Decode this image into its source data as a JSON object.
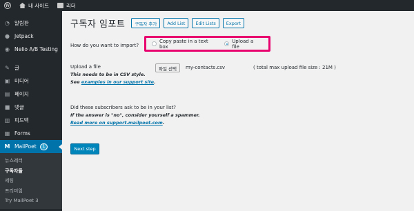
{
  "admin_bar": {
    "site_label": "내 사이트",
    "reader_label": "리더"
  },
  "sidebar": {
    "items": [
      {
        "label": "알림판",
        "icon": "dashboard-icon"
      },
      {
        "label": "Jetpack",
        "icon": "jetpack-icon"
      },
      {
        "label": "Nelio A/B Testing",
        "icon": "nelio-icon"
      },
      {
        "label": "글",
        "icon": "pin-icon"
      },
      {
        "label": "미디어",
        "icon": "media-icon"
      },
      {
        "label": "페이지",
        "icon": "page-icon"
      },
      {
        "label": "댓글",
        "icon": "comment-icon"
      },
      {
        "label": "피드백",
        "icon": "feedback-icon"
      },
      {
        "label": "Forms",
        "icon": "forms-icon"
      }
    ],
    "active": {
      "label": "MailPoet",
      "badge": "1",
      "icon": "mailpoet-icon"
    },
    "submenu": [
      "뉴스레터",
      "구독자들",
      "세팅",
      "프리미엄",
      "Try MailPoet 3"
    ],
    "current_submenu": "구독자들"
  },
  "header": {
    "title": "구독자 임포트",
    "buttons": [
      "구독자 추가",
      "Add List",
      "Edit Lists",
      "Export"
    ]
  },
  "import": {
    "question": "How do you want to import?",
    "options": [
      "Copy paste in a text box",
      "Upload a file"
    ],
    "selected": "Upload a file"
  },
  "upload": {
    "label": "Upload a file",
    "hint_csv": "This needs to be in CSV style.",
    "hint_see": "See",
    "hint_link": "examples in our support site",
    "choose_button": "파일 선택",
    "file_name": "my-contacts.csv",
    "max_size": "( total max upload file size : 21M )"
  },
  "subscribers": {
    "question": "Did these subscribers ask to be in your list?",
    "hint_spammer": "If the answer is \"no\", consider yourself a spammer.",
    "link": "Read more on support.mailpoet.com"
  },
  "next_button": "Next step"
}
